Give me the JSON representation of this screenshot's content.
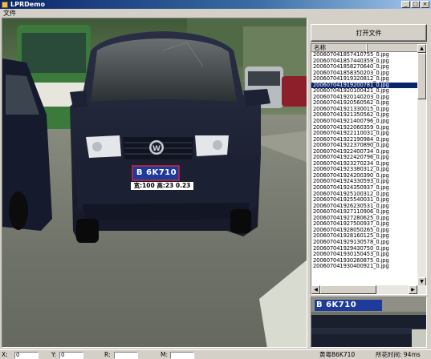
{
  "window": {
    "title": "LPRDemo",
    "minimize": "_",
    "maximize": "□",
    "close": "×"
  },
  "menu": {
    "file": "文件"
  },
  "toolbar": {
    "open_file": "打开文件"
  },
  "filelist": {
    "column": "名称",
    "selected_index": 5,
    "items": [
      "20060704185741075​5_0.jpg",
      "20060704185744035​9_0.jpg",
      "200607041858270640_0.jpg",
      "200607041858350203_0.jpg",
      "200607041919320812_0.jpg",
      "200607041919200781_0.jpg",
      "200607041920100421_0.jpg",
      "200607041920140203_0.jpg",
      "200607041920560562_0.jpg",
      "200607041921330015_0.jpg",
      "200607041921350562_0.jpg",
      "200607041921400796_0.jpg",
      "200607041922060359_0.jpg",
      "200607041922110031_0.jpg",
      "200607041922190984_0.jpg",
      "200607041922370890_0.jpg",
      "200607041922400734_0.jpg",
      "200607041922420796_0.jpg",
      "200607041923270234_0.jpg",
      "200607041923380312_0.jpg",
      "200607041924200390_0.jpg",
      "200607041924330593_0.jpg",
      "200607041924350937_0.jpg",
      "200607041925100312_0.jpg",
      "200607041925540031_0.jpg",
      "200607041926230531_0.jpg",
      "200607041927110906_0.jpg",
      "200607041927280625_0.jpg",
      "200607041927500937_0.jpg",
      "200607041928050265_0.jpg",
      "200607041928160125_0.jpg",
      "200607041929130578_0.jpg",
      "200607041929430750_0.jpg",
      "200607041930150453_0.jpg",
      "200607041930260875_0.jpg",
      "200607041930400921_0.jpg"
    ]
  },
  "image": {
    "plate_text": "B 6K710",
    "plate_annotation": "宽:100 高:23 0.23",
    "crop_plate_text": "B 6K710"
  },
  "status": {
    "x_label": "X:",
    "x_value": "0",
    "y_label": "Y:",
    "y_value": "0",
    "r_label": "R:",
    "m_label": "M:",
    "result": "黄粤B6K710",
    "elapsed": "所花时间: 94ms"
  }
}
